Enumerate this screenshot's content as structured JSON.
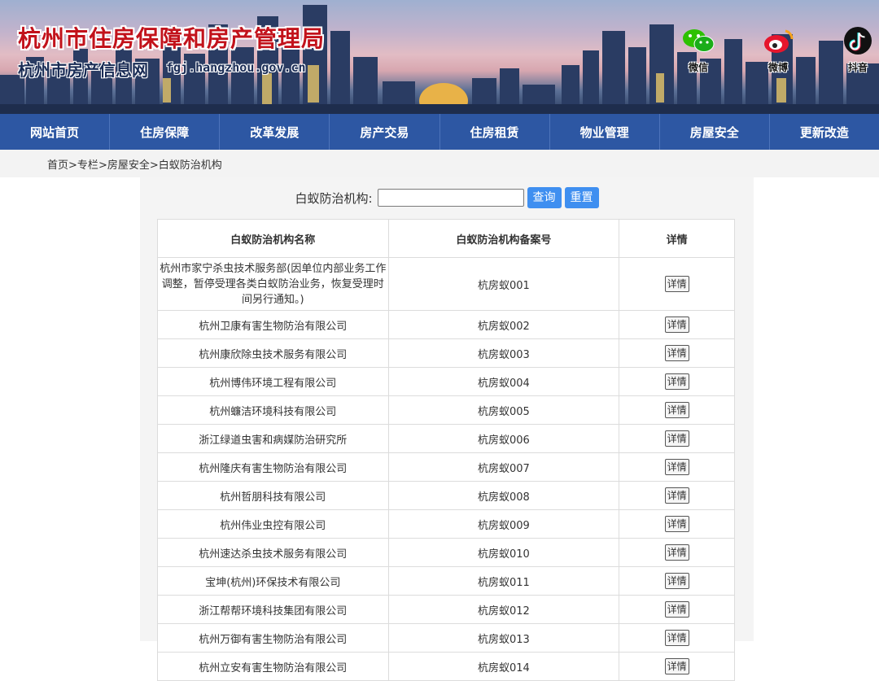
{
  "header": {
    "title": "杭州市住房保障和房产管理局",
    "subtitle": "杭州市房产信息网",
    "domain": "fgj.hangzhou.gov.cn",
    "social": [
      {
        "label": "微信",
        "icon": "wechat-icon"
      },
      {
        "label": "微博",
        "icon": "weibo-icon"
      },
      {
        "label": "抖音",
        "icon": "douyin-icon"
      }
    ]
  },
  "nav": [
    "网站首页",
    "住房保障",
    "改革发展",
    "房产交易",
    "住房租赁",
    "物业管理",
    "房屋安全",
    "更新改造"
  ],
  "breadcrumb": [
    "首页",
    "专栏",
    "房屋安全",
    "白蚁防治机构"
  ],
  "breadcrumb_sep": ">",
  "search": {
    "label": "白蚁防治机构:",
    "value": "",
    "query_label": "查询",
    "reset_label": "重置"
  },
  "table": {
    "headers": [
      "白蚁防治机构名称",
      "白蚁防治机构备案号",
      "详情"
    ],
    "detail_label": "详情",
    "rows": [
      {
        "name": "杭州市家宁杀虫技术服务部(因单位内部业务工作调整，暂停受理各类白蚁防治业务，恢复受理时间另行通知。)",
        "code": "杭房蚁001"
      },
      {
        "name": "杭州卫康有害生物防治有限公司",
        "code": "杭房蚁002"
      },
      {
        "name": "杭州康欣除虫技术服务有限公司",
        "code": "杭房蚁003"
      },
      {
        "name": "杭州博伟环境工程有限公司",
        "code": "杭房蚁004"
      },
      {
        "name": "杭州蠊洁环境科技有限公司",
        "code": "杭房蚁005"
      },
      {
        "name": "浙江绿道虫害和病媒防治研究所",
        "code": "杭房蚁006"
      },
      {
        "name": "杭州隆庆有害生物防治有限公司",
        "code": "杭房蚁007"
      },
      {
        "name": "杭州哲朋科技有限公司",
        "code": "杭房蚁008"
      },
      {
        "name": "杭州伟业虫控有限公司",
        "code": "杭房蚁009"
      },
      {
        "name": "杭州速达杀虫技术服务有限公司",
        "code": "杭房蚁010"
      },
      {
        "name": "宝坤(杭州)环保技术有限公司",
        "code": "杭房蚁011"
      },
      {
        "name": "浙江帮帮环境科技集团有限公司",
        "code": "杭房蚁012"
      },
      {
        "name": "杭州万御有害生物防治有限公司",
        "code": "杭房蚁013"
      },
      {
        "name": "杭州立安有害生物防治有限公司",
        "code": "杭房蚁014"
      }
    ]
  },
  "colors": {
    "nav_bg": "#2d57a3",
    "title_red": "#c2121b",
    "button_blue": "#3f8ff0"
  }
}
